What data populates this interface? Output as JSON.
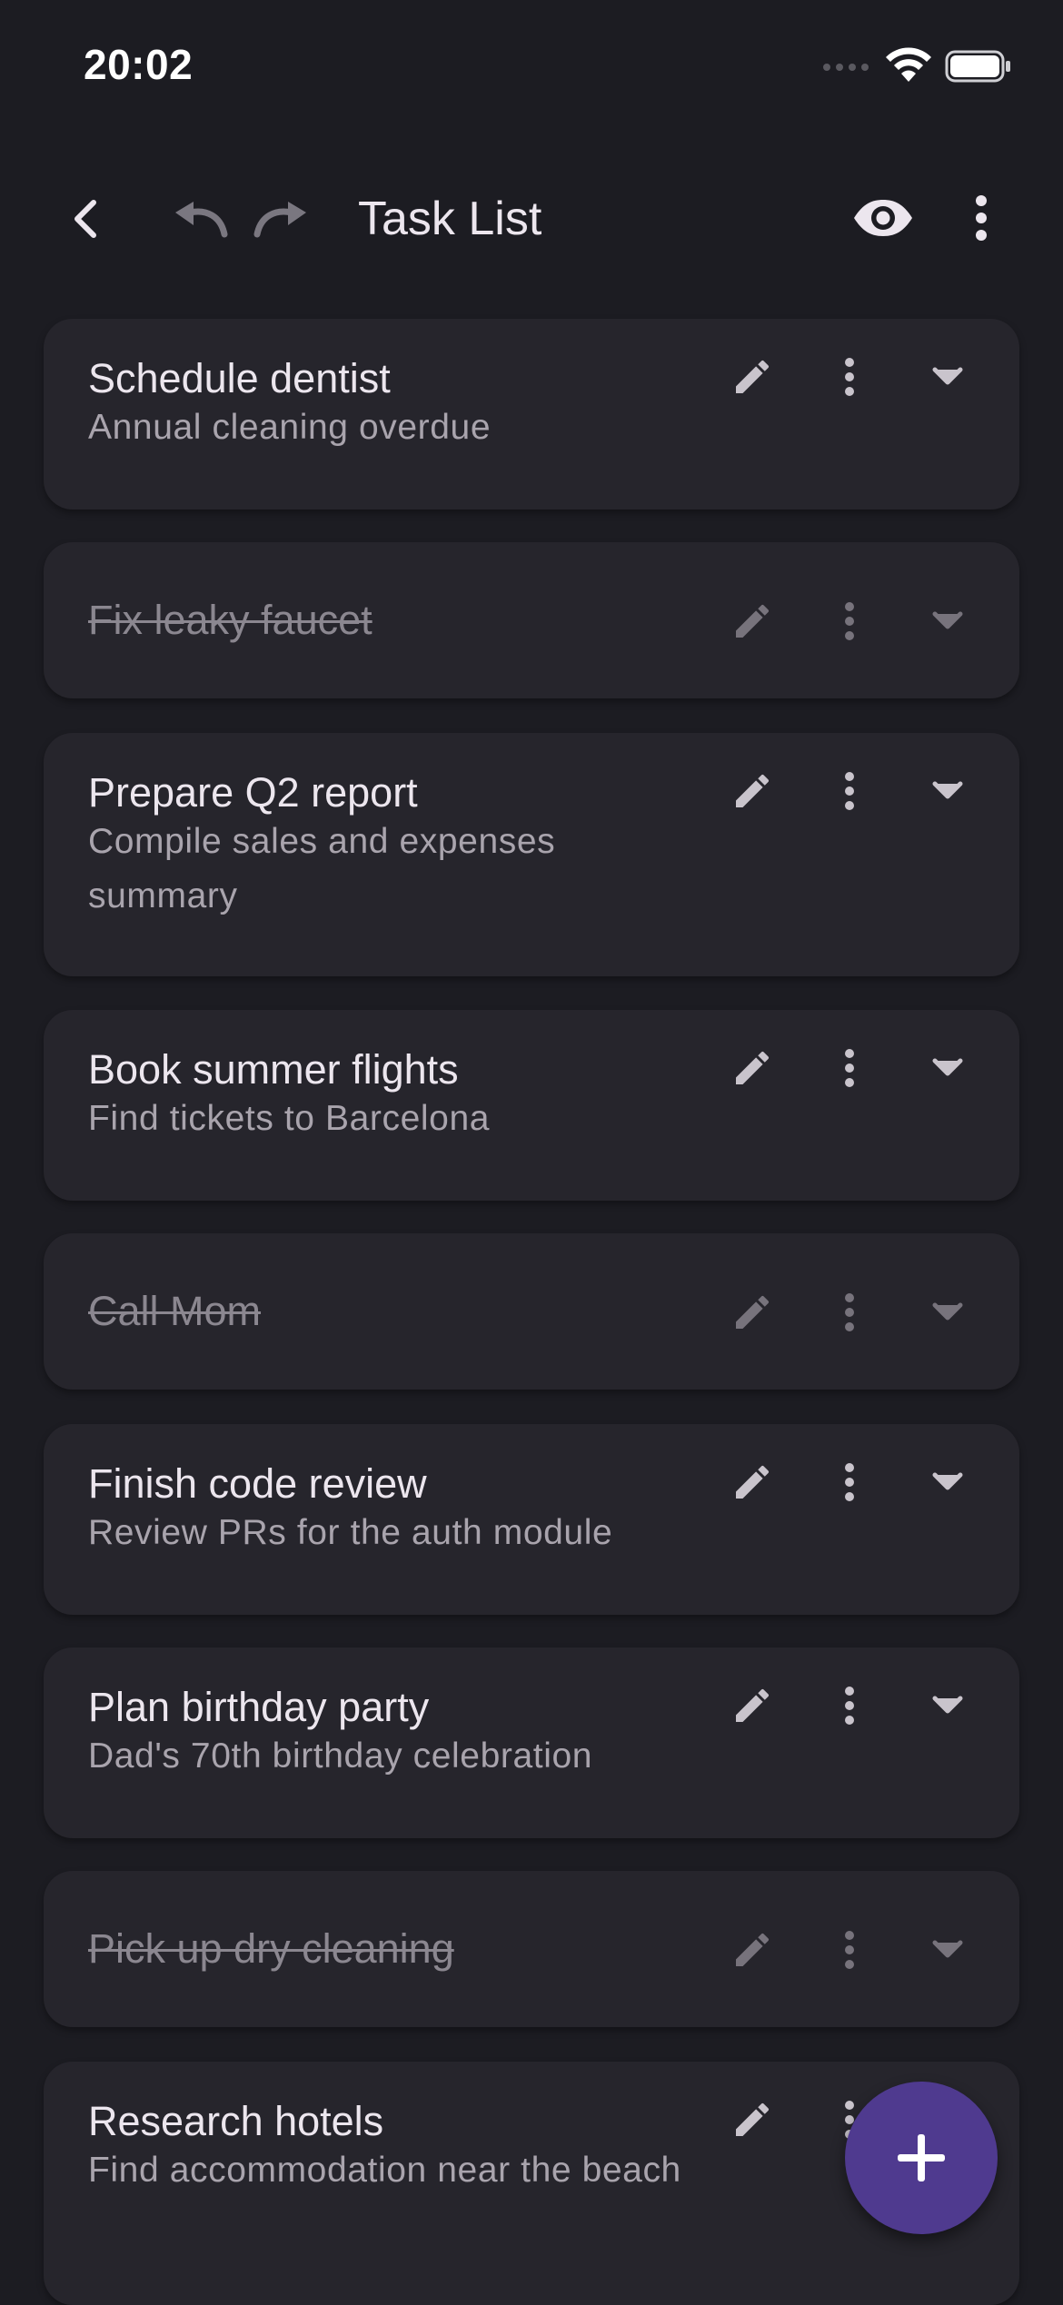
{
  "status_bar": {
    "time": "20:02"
  },
  "app_bar": {
    "title": "Task List"
  },
  "tasks": [
    {
      "title": "Schedule dentist",
      "description": "Annual cleaning overdue",
      "completed": false
    },
    {
      "title": "Fix leaky faucet",
      "description": "",
      "completed": true
    },
    {
      "title": "Prepare Q2 report",
      "description": "Compile sales and expenses summary",
      "completed": false
    },
    {
      "title": "Book summer flights",
      "description": "Find tickets to Barcelona",
      "completed": false
    },
    {
      "title": "Call Mom",
      "description": "",
      "completed": true
    },
    {
      "title": "Finish code review",
      "description": "Review PRs for the auth module",
      "completed": false
    },
    {
      "title": "Plan birthday party",
      "description": "Dad's 70th birthday celebration",
      "completed": false
    },
    {
      "title": "Pick up dry cleaning",
      "description": "",
      "completed": true
    },
    {
      "title": "Research hotels",
      "description": "Find accommodation near the beach",
      "completed": false
    }
  ],
  "colors": {
    "background": "#1c1c22",
    "card": "#26252c",
    "fab": "#4f3a8f",
    "text_primary": "#ece6ee",
    "text_secondary": "#a9a4ad",
    "text_completed": "#8b8790"
  },
  "icons": {
    "back": "arrow-back-icon",
    "undo": "undo-icon",
    "redo": "redo-icon",
    "visibility": "eye-icon",
    "more": "more-vert-icon",
    "edit": "pencil-icon",
    "expand": "chevron-down-icon",
    "add": "plus-icon"
  }
}
